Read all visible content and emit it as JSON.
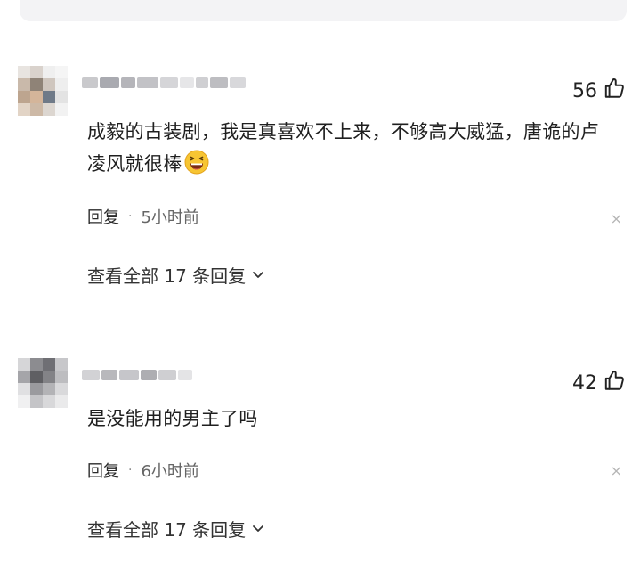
{
  "comments": [
    {
      "likes": "56",
      "text": "成毅的古装剧，我是真喜欢不上来，不够高大威猛，唐诡的卢凌风就很棒",
      "reply_label": "回复",
      "dot": "·",
      "time": "5小时前",
      "close": "×",
      "view_all": "查看全部 17 条回复"
    },
    {
      "likes": "42",
      "text": "是没能用的男主了吗",
      "reply_label": "回复",
      "dot": "·",
      "time": "6小时前",
      "close": "×",
      "view_all": "查看全部 17 条回复"
    }
  ],
  "icons": {
    "like": "thumbs-up-icon",
    "emoji": "laughing-emoji-icon",
    "expand": "chevron-down-icon"
  }
}
